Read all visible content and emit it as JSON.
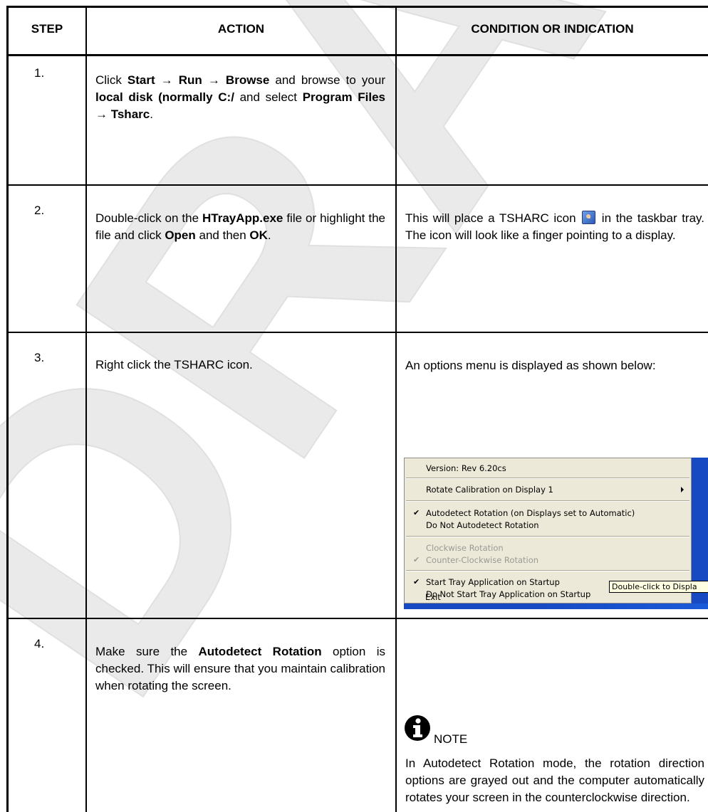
{
  "headers": {
    "step": "STEP",
    "action": "ACTION",
    "condition": "CONDITION OR INDICATION"
  },
  "rows": [
    {
      "step": "1.",
      "action": [
        {
          "t": "Click ",
          "b": false
        },
        {
          "t": "Start",
          "b": true
        },
        {
          "t": " → ",
          "b": true
        },
        {
          "t": "Run",
          "b": true
        },
        {
          "t": " → ",
          "b": true
        },
        {
          "t": "Browse",
          "b": true
        },
        {
          "t": " and browse to your ",
          "b": false
        },
        {
          "t": "local disk (normally C:/",
          "b": true
        },
        {
          "t": " and select ",
          "b": false
        },
        {
          "t": "Program Files",
          "b": true
        },
        {
          "t": " → ",
          "b": true
        },
        {
          "t": "Tsharc",
          "b": true
        },
        {
          "t": ".",
          "b": false
        }
      ]
    },
    {
      "step": "2.",
      "action": [
        {
          "t": "Double-click on the ",
          "b": false
        },
        {
          "t": "HTrayApp.exe",
          "b": true
        },
        {
          "t": " file or highlight the file and click ",
          "b": false
        },
        {
          "t": "Open",
          "b": true
        },
        {
          "t": " and then ",
          "b": false
        },
        {
          "t": "OK",
          "b": true
        },
        {
          "t": ".",
          "b": false
        }
      ],
      "condition_before_icon": "This will place a TSHARC icon",
      "condition_after_icon": "in the taskbar tray. The icon will look like a finger pointing to a display."
    },
    {
      "step": "3.",
      "action_text": "Right click the TSHARC icon.",
      "condition": "An options menu is displayed as shown below:"
    },
    {
      "step": "4.",
      "action": [
        {
          "t": "Make sure the ",
          "b": false
        },
        {
          "t": "Autodetect Rotation",
          "b": true
        },
        {
          "t": " option is checked. This will ensure that you maintain calibration when rotating the screen.",
          "b": false
        }
      ],
      "note_label": "NOTE",
      "note_text": "In Autodetect Rotation mode, the rotation direction options are grayed out and the computer automatically rotates your screen in the counterclockwise direction."
    }
  ],
  "menu": {
    "version": "Version:  Rev 6.20cs",
    "rotate_calibration": "Rotate Calibration on Display 1",
    "autodetect": "Autodetect Rotation (on Displays set to Automatic)",
    "no_autodetect": "Do Not Autodetect Rotation",
    "clockwise": "Clockwise Rotation",
    "counter_clockwise": "Counter-Clockwise Rotation",
    "start_tray": "Start Tray Application on Startup",
    "no_start_tray": "Do Not Start Tray Application on Startup",
    "exit": "Exit",
    "tooltip": "Double-click to Displa",
    "check_glyph": "✔"
  },
  "watermark": "DRAFT"
}
